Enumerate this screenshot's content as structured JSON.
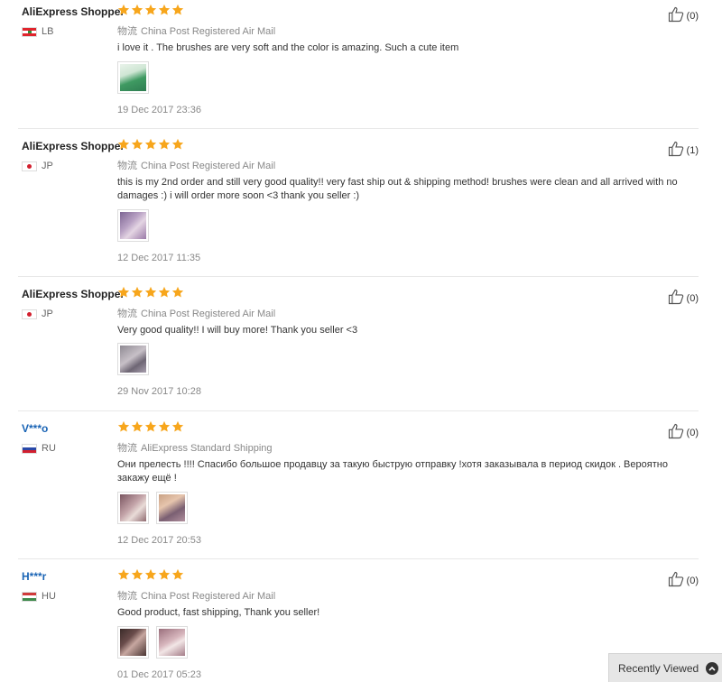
{
  "reviews": [
    {
      "user": "AliExpress Shopper",
      "user_link": false,
      "country": "LB",
      "flag": "lb",
      "shipping_label": "物流",
      "shipping": "China Post Registered Air Mail",
      "text": "i love it . The brushes are very soft and the color is amazing. Such a cute item",
      "images": [
        "green"
      ],
      "date": "19 Dec 2017 23:36",
      "likes": "(0)"
    },
    {
      "user": "AliExpress Shopper",
      "user_link": false,
      "country": "JP",
      "flag": "jp",
      "shipping_label": "物流",
      "shipping": "China Post Registered Air Mail",
      "text": "this is my 2nd order and still very good quality!! very fast ship out & shipping method! brushes were clean and all arrived with no damages :) i will order more soon <3 thank you seller :)",
      "images": [
        "purple"
      ],
      "date": "12 Dec 2017 11:35",
      "likes": "(1)"
    },
    {
      "user": "AliExpress Shopper",
      "user_link": false,
      "country": "JP",
      "flag": "jp",
      "shipping_label": "物流",
      "shipping": "China Post Registered Air Mail",
      "text": "Very good quality!! I will buy more! Thank you seller <3",
      "images": [
        "grey"
      ],
      "date": "29 Nov 2017 10:28",
      "likes": "(0)"
    },
    {
      "user": "V***o",
      "user_link": true,
      "country": "RU",
      "flag": "ru",
      "shipping_label": "物流",
      "shipping": "AliExpress Standard Shipping",
      "text": "Они прелесть !!!! Спасибо большое продавцу за такую быструю отправку !хотя заказывала в период скидок . Вероятно закажу ещё !",
      "images": [
        "mauve",
        "hand"
      ],
      "date": "12 Dec 2017 20:53",
      "likes": "(0)"
    },
    {
      "user": "H***r",
      "user_link": true,
      "country": "HU",
      "flag": "hu",
      "shipping_label": "物流",
      "shipping": "China Post Registered Air Mail",
      "text": "Good product, fast shipping, Thank you seller!",
      "images": [
        "dark",
        "rose"
      ],
      "date": "01 Dec 2017 05:23",
      "likes": "(0)"
    }
  ],
  "recently_viewed": "Recently Viewed",
  "colors": {
    "star": "#f7a61c",
    "link": "#1a64b5",
    "divider": "#e8e8e8"
  }
}
